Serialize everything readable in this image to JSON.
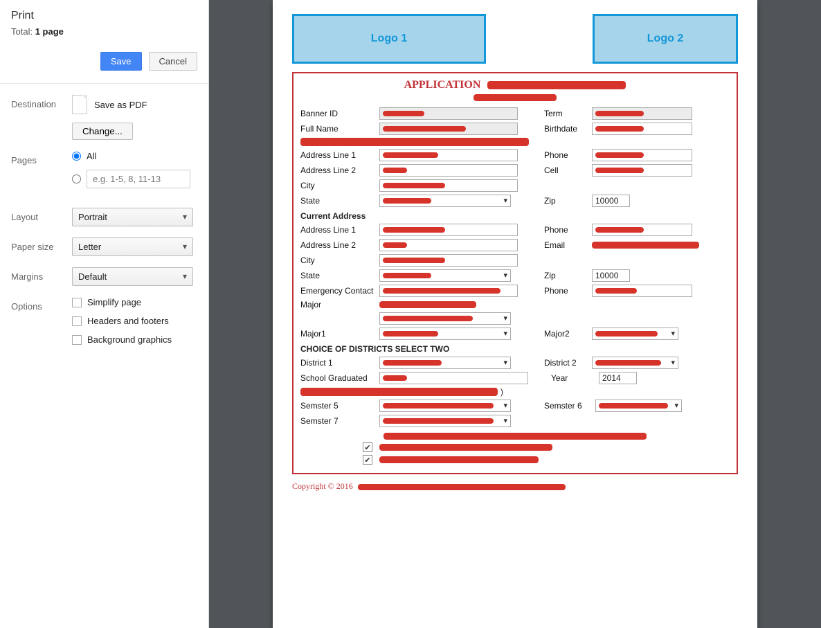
{
  "sidebar": {
    "title": "Print",
    "total_prefix": "Total: ",
    "total_value": "1 page",
    "save_label": "Save",
    "cancel_label": "Cancel",
    "destination": {
      "label": "Destination",
      "value": "Save as PDF",
      "change": "Change..."
    },
    "pages": {
      "label": "Pages",
      "all": "All",
      "placeholder": "e.g. 1-5, 8, 11-13"
    },
    "layout": {
      "label": "Layout",
      "value": "Portrait"
    },
    "paper": {
      "label": "Paper size",
      "value": "Letter"
    },
    "margins": {
      "label": "Margins",
      "value": "Default"
    },
    "options": {
      "label": "Options",
      "simplify": "Simplify page",
      "headers": "Headers and footers",
      "bg": "Background graphics"
    }
  },
  "page": {
    "logo1": "Logo 1",
    "logo2": "Logo 2",
    "app_title": "APPLICATION",
    "copyright": "Copyright © 2016",
    "labels": {
      "banner": "Banner ID",
      "term": "Term",
      "fullname": "Full Name",
      "birthdate": "Birthdate",
      "addr1": "Address Line 1",
      "addr2": "Address Line 2",
      "city": "City",
      "state": "State",
      "phone": "Phone",
      "cell": "Cell",
      "zip": "Zip",
      "currentaddr": "Current Address",
      "email": "Email",
      "emergency": "Emergency Contact",
      "major": "Major",
      "major1": "Major1",
      "major2": "Major2",
      "choice": "CHOICE OF DISTRICTS SELECT TWO",
      "district1": "District 1",
      "district2": "District 2",
      "school": "School Graduated",
      "year": "Year",
      "sem5": "Semster 5",
      "sem6": "Semster 6",
      "sem7": "Semster 7"
    },
    "values": {
      "zip1": "10000",
      "zip2": "10000",
      "year": "2014",
      "checked1": "✔",
      "checked2": "✔",
      "paren": ")"
    }
  }
}
